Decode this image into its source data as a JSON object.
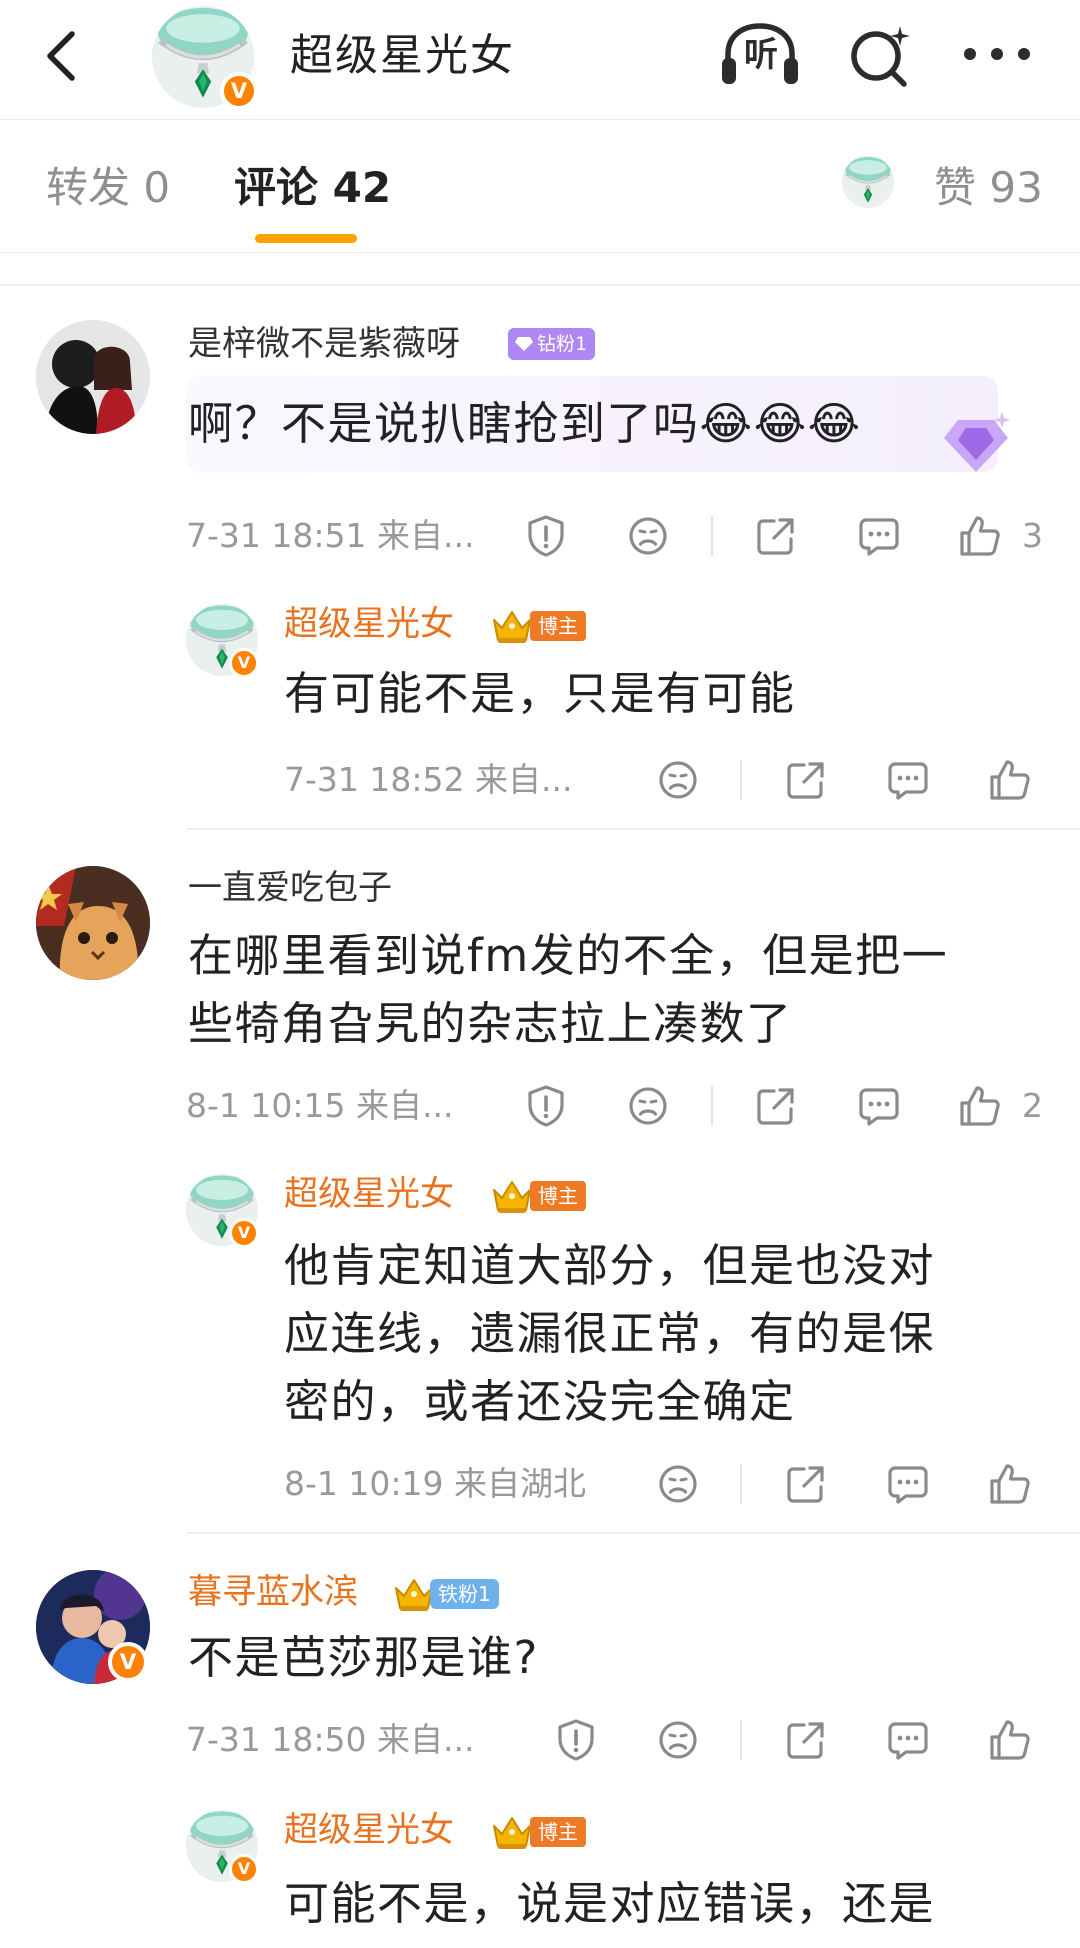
{
  "header": {
    "title": "超级星光女",
    "listen_label": "听",
    "verified_label": "V"
  },
  "tabs": {
    "repost": "转发 0",
    "comments": "评论 42",
    "likes": "赞 93"
  },
  "labels": {
    "blogger": "博主",
    "diamond_fan": "钻粉1",
    "iron_fan": "铁粉1"
  },
  "comments": [
    {
      "user": "是梓微不是紫薇呀",
      "badge": "钻粉1",
      "text": "啊？不是说扒瞎抢到了吗😂😂😂",
      "meta": "7-31 18:51  来自...",
      "likes": "3",
      "reply": {
        "user": "超级星光女",
        "text": "有可能不是，只是有可能",
        "meta": "7-31 18:52  来自..."
      }
    },
    {
      "user": "一直爱吃包子",
      "text_lines": [
        "在哪里看到说fm发的不全，但是把一",
        "些犄角旮旯的杂志拉上凑数了"
      ],
      "meta": "8-1 10:15  来自...",
      "likes": "2",
      "reply": {
        "user": "超级星光女",
        "text_lines": [
          "他肯定知道大部分，但是也没对",
          "应连线，遗漏很正常，有的是保",
          "密的，或者还没完全确定"
        ],
        "meta": "8-1 10:19  来自湖北"
      }
    },
    {
      "user": "暮寻蓝水滨",
      "badge": "铁粉1",
      "text": "不是芭莎那是谁?",
      "meta": "7-31 18:50  来自...",
      "reply": {
        "user": "超级星光女",
        "text": "可能不是，说是对应错误，还是"
      }
    }
  ],
  "colors": {
    "accent": "#ffa200",
    "orange_name": "#e8721d",
    "verified": "#ff8200",
    "diamond_badge": "#ad87f2",
    "iron_badge": "#6fb2ea",
    "meta_gray": "#999999"
  }
}
